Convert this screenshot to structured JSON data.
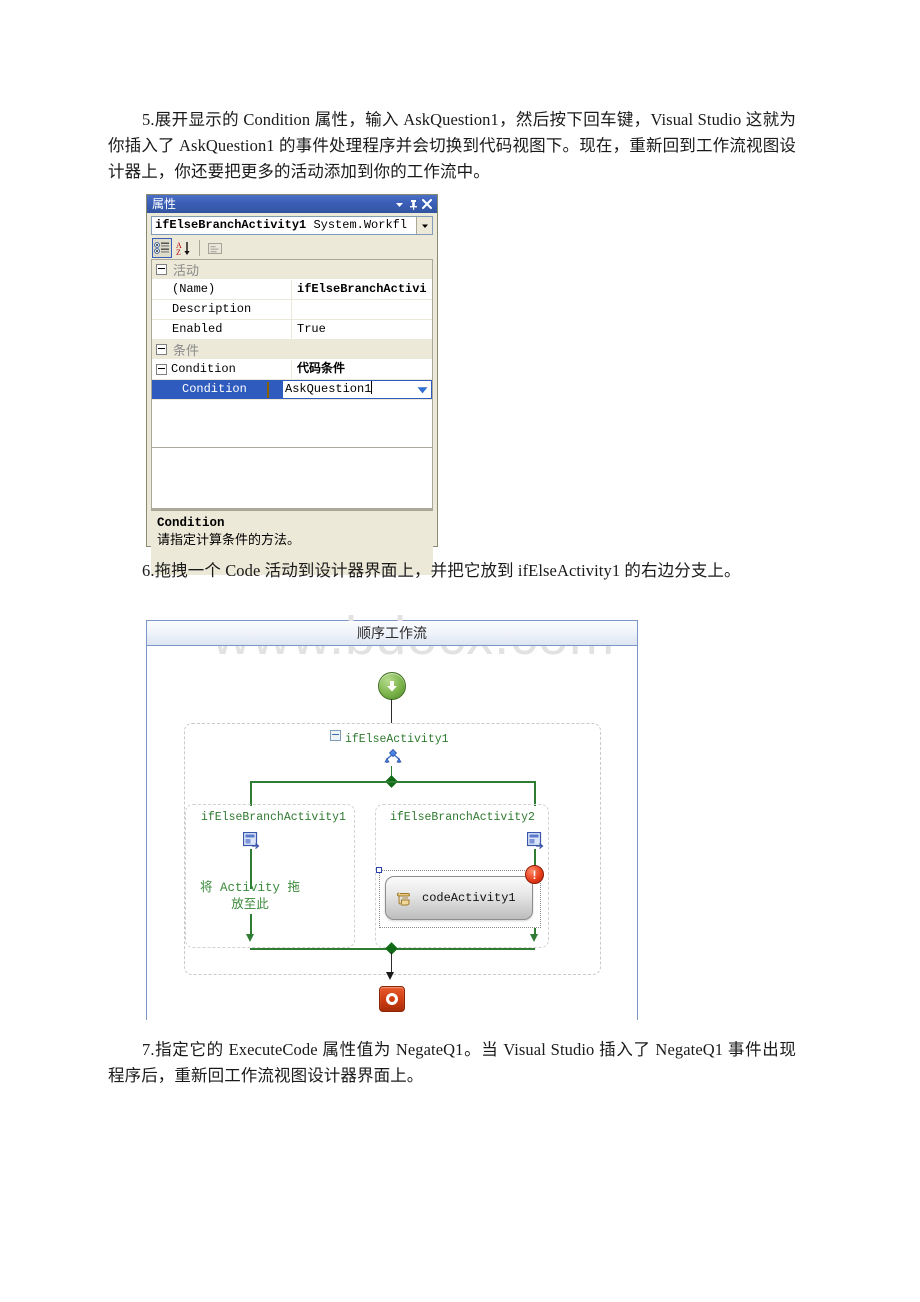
{
  "paragraphs": {
    "p5": "5.展开显示的 Condition 属性，输入 AskQuestion1，然后按下回车键，Visual Studio 这就为你插入了 AskQuestion1 的事件处理程序并会切换到代码视图下。现在，重新回到工作流视图设计器上，你还要把更多的活动添加到你的工作流中。",
    "p6": "6.拖拽一个 Code 活动到设计器界面上，并把它放到 ifElseActivity1 的右边分支上。",
    "p7": "7.指定它的 ExecuteCode 属性值为 NegateQ1。当 Visual Studio 插入了 NegateQ1 事件出现程序后，重新回工作流视图设计器界面上。"
  },
  "properties_window": {
    "title": "属性",
    "titlebar_buttons": {
      "dropdown": "▾",
      "pin": "pin-icon",
      "close": "✕"
    },
    "object_selector": {
      "name": "ifElseBranchActivity1",
      "type": "System.Workfl",
      "dropdown": "▾"
    },
    "toolbar": {
      "categorized": "categorized-view-icon",
      "alphabetical": "alphabetical-sort-icon",
      "property_pages": "property-pages-icon"
    },
    "grid": {
      "categories": [
        {
          "label": "活动",
          "rows": [
            {
              "name": "(Name)",
              "value": "ifElseBranchActivi",
              "bold": true
            },
            {
              "name": "Description",
              "value": ""
            },
            {
              "name": "Enabled",
              "value": "True"
            }
          ]
        },
        {
          "label": "条件",
          "rows": [
            {
              "name": "Condition",
              "value": "代码条件",
              "bold": true,
              "expandable": true
            }
          ],
          "selected_row": {
            "name": "Condition",
            "value": "AskQuestion1",
            "editor_icon": "event-handler-icon",
            "dropdown": "▾"
          }
        }
      ]
    },
    "description": {
      "title": "Condition",
      "text": "请指定计算条件的方法。"
    }
  },
  "workflow_designer": {
    "header_title": "顺序工作流",
    "watermark": "www.bdocx.com",
    "start_node": "start-node-icon",
    "end_node": "end-node-icon",
    "ifelse_activity": {
      "label": "ifElseActivity1",
      "collapse": "collapse-icon",
      "branch_icon": "ifelse-branch-icon"
    },
    "branches": [
      {
        "label": "ifElseBranchActivity1",
        "icon": "branch-activity-icon",
        "drop_hint": "将 Activity 拖\n放至此"
      },
      {
        "label": "ifElseBranchActivity2",
        "icon": "branch-activity-icon",
        "activity": {
          "label": "codeActivity1",
          "icon": "code-scroll-icon",
          "error_badge": "!"
        }
      }
    ]
  },
  "colors": {
    "titlebar_blue": "#3b5fb8",
    "selection_blue": "#2f5bbf",
    "workflow_green": "#2e7d32",
    "error_red": "#cf3d12",
    "designer_border": "#7b96c6"
  }
}
